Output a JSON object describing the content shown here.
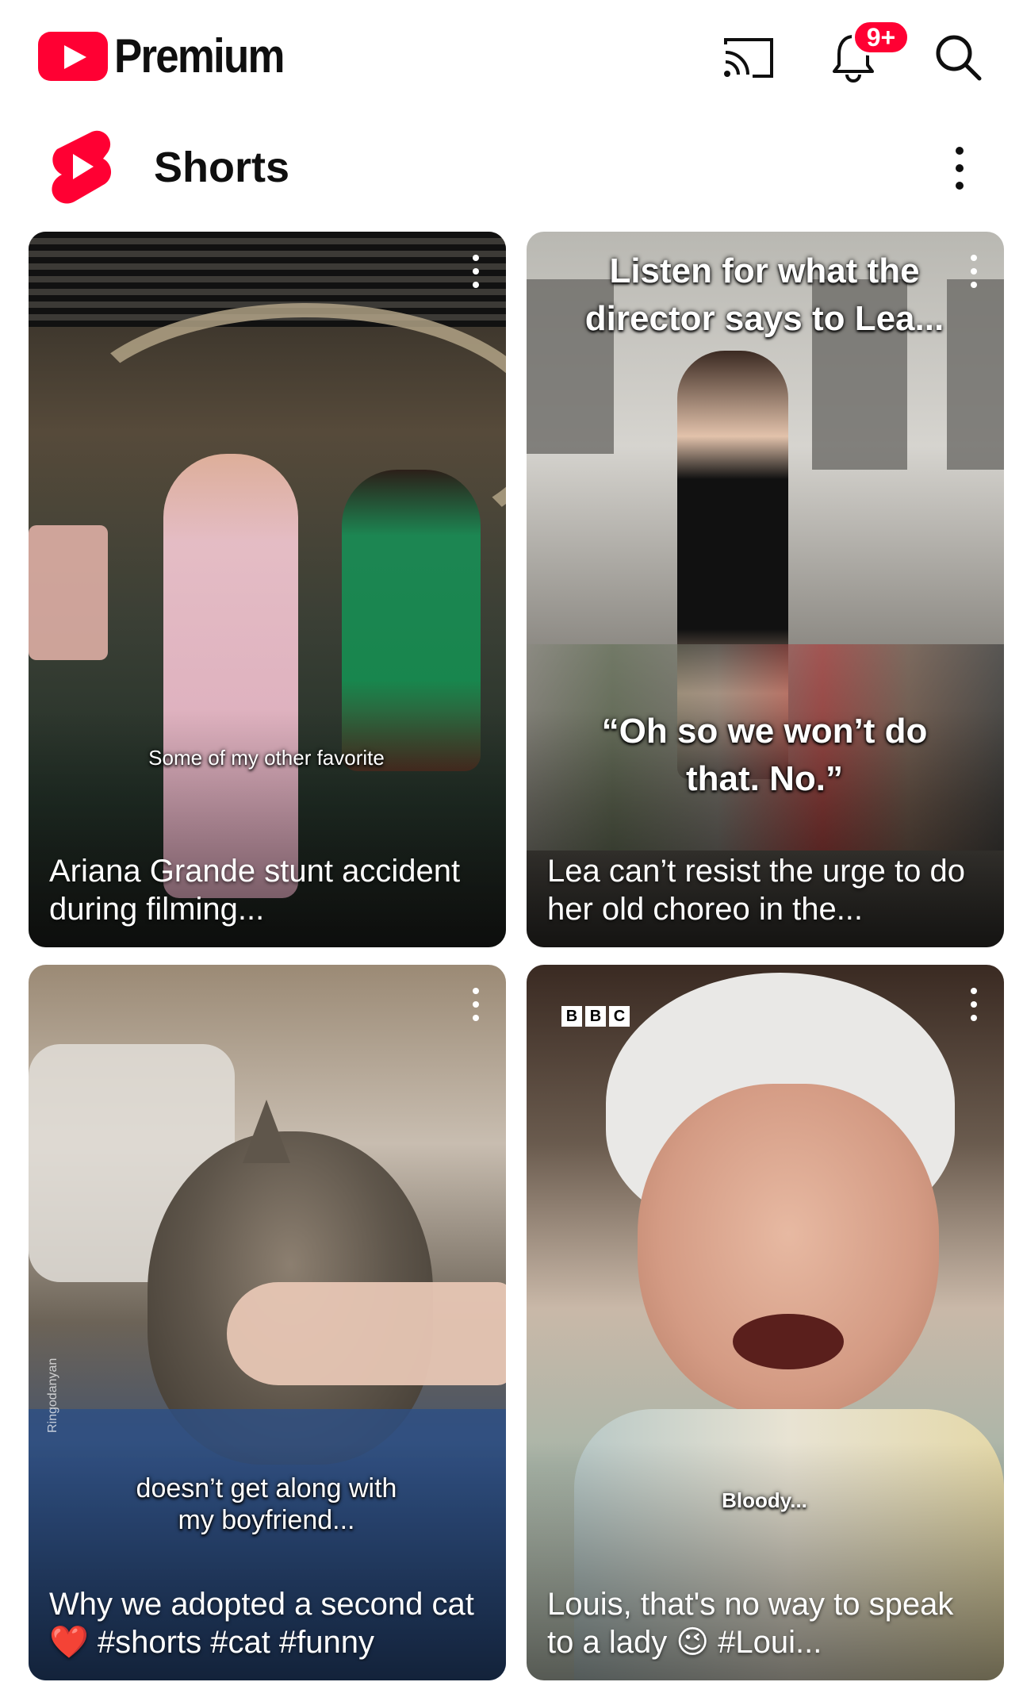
{
  "header": {
    "brand": "Premium",
    "notification_count": "9+"
  },
  "section": {
    "title": "Shorts"
  },
  "shorts": [
    {
      "overlay_lines": [
        "Some of my other favorite"
      ],
      "title": "Ariana Grande stunt accident during filming..."
    },
    {
      "overlay_lines": [
        "Listen for what the director says to Lea...",
        "“Oh so we won’t do that. No.”"
      ],
      "title": "Lea can’t resist the urge to do her old choreo in the..."
    },
    {
      "overlay_lines": [
        "doesn’t get along with my boyfriend..."
      ],
      "credit": "Ringodanyan",
      "title": "Why we adopted a second cat❤️ #shorts #cat #funny"
    },
    {
      "overlay_lines": [
        "Bloody..."
      ],
      "channel_mark": [
        "B",
        "B",
        "C"
      ],
      "title": "Louis, that's no way to speak to a lady 😉 #Loui..."
    }
  ],
  "colors": {
    "brand_red": "#ff0033",
    "text": "#0f0f0f",
    "background": "#ffffff"
  },
  "icons": {
    "cast": "cast-icon",
    "notifications": "bell-icon",
    "search": "search-icon",
    "more": "more-vert-icon",
    "shorts": "shorts-logo-icon"
  }
}
